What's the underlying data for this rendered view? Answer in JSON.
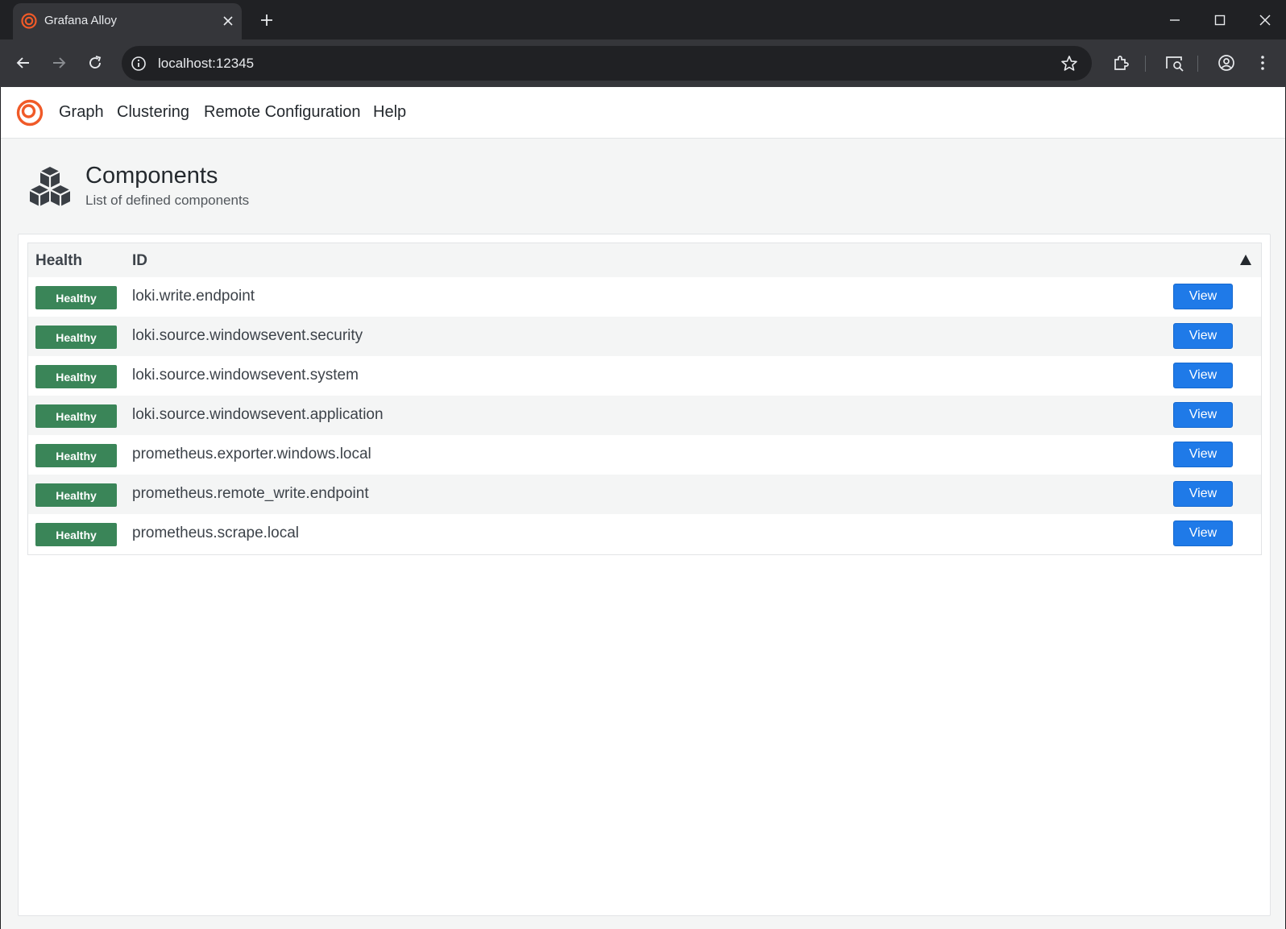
{
  "browser": {
    "tab_title": "Grafana Alloy",
    "url": "localhost:12345"
  },
  "nav": {
    "links": [
      "Graph",
      "Clustering",
      "Remote Configuration",
      "Help"
    ]
  },
  "header": {
    "title": "Components",
    "subtitle": "List of defined components"
  },
  "table": {
    "columns": [
      "Health",
      "ID"
    ],
    "sort_indicator": "▲",
    "rows": [
      {
        "health": "Healthy",
        "id": "loki.write.endpoint",
        "action": "View"
      },
      {
        "health": "Healthy",
        "id": "loki.source.windowsevent.security",
        "action": "View"
      },
      {
        "health": "Healthy",
        "id": "loki.source.windowsevent.system",
        "action": "View"
      },
      {
        "health": "Healthy",
        "id": "loki.source.windowsevent.application",
        "action": "View"
      },
      {
        "health": "Healthy",
        "id": "prometheus.exporter.windows.local",
        "action": "View"
      },
      {
        "health": "Healthy",
        "id": "prometheus.remote_write.endpoint",
        "action": "View"
      },
      {
        "health": "Healthy",
        "id": "prometheus.scrape.local",
        "action": "View"
      }
    ]
  },
  "colors": {
    "healthy": "#3a8558",
    "primary_button": "#1f7ae8",
    "brand": "#f05a28"
  }
}
